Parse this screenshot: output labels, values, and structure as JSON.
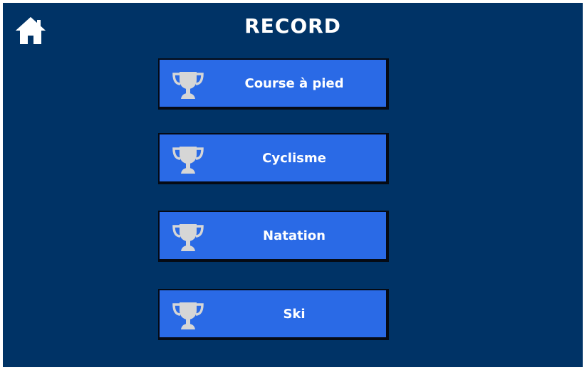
{
  "header": {
    "title": "RECORD",
    "home_icon": "home-icon"
  },
  "records": [
    {
      "label": "Course à pied",
      "icon": "trophy-icon"
    },
    {
      "label": "Cyclisme",
      "icon": "trophy-icon"
    },
    {
      "label": "Natation",
      "icon": "trophy-icon"
    },
    {
      "label": "Ski",
      "icon": "trophy-icon"
    }
  ],
  "colors": {
    "background": "#003366",
    "button": "#2a6ae6",
    "trophy": "#d6d6d6",
    "text": "#ffffff"
  }
}
